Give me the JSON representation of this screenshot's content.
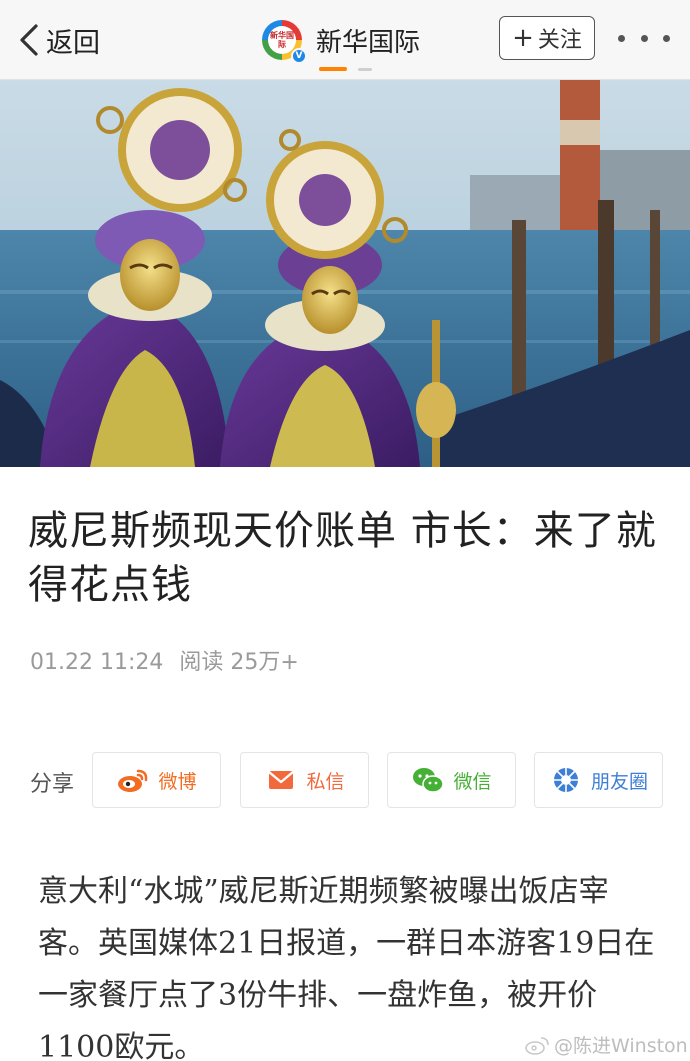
{
  "header": {
    "back_label": "返回",
    "account_name": "新华国际",
    "logo_text": "新华国际",
    "verified_mark": "V",
    "follow_plus": "+",
    "follow_label": "关注",
    "colors": {
      "active_tab": "#ff8200",
      "verified": "#1e88e5"
    }
  },
  "hero": {
    "image_icon": "venice-carnival-photo"
  },
  "article": {
    "title": "威尼斯频现天价账单 市长：来了就得花点钱",
    "date": "01.22 11:24",
    "read_count": "阅读 25万+"
  },
  "share": {
    "label": "分享",
    "buttons": [
      {
        "label": "微博",
        "icon": "weibo-icon",
        "color": "#f36c21"
      },
      {
        "label": "私信",
        "icon": "mail-icon",
        "color": "#f26a3c"
      },
      {
        "label": "微信",
        "icon": "wechat-icon",
        "color": "#45b035"
      },
      {
        "label": "朋友圈",
        "icon": "moments-icon",
        "color": "#3d7ed6"
      }
    ]
  },
  "body": {
    "paragraph": "意大利“水城”威尼斯近期频繁被曝出饭店宰客。英国媒体21日报道，一群日本游客19日在一家餐厅点了3份牛排、一盘炸鱼，被开价1100欧元。"
  },
  "watermark": {
    "text": "@陈进Winston"
  }
}
